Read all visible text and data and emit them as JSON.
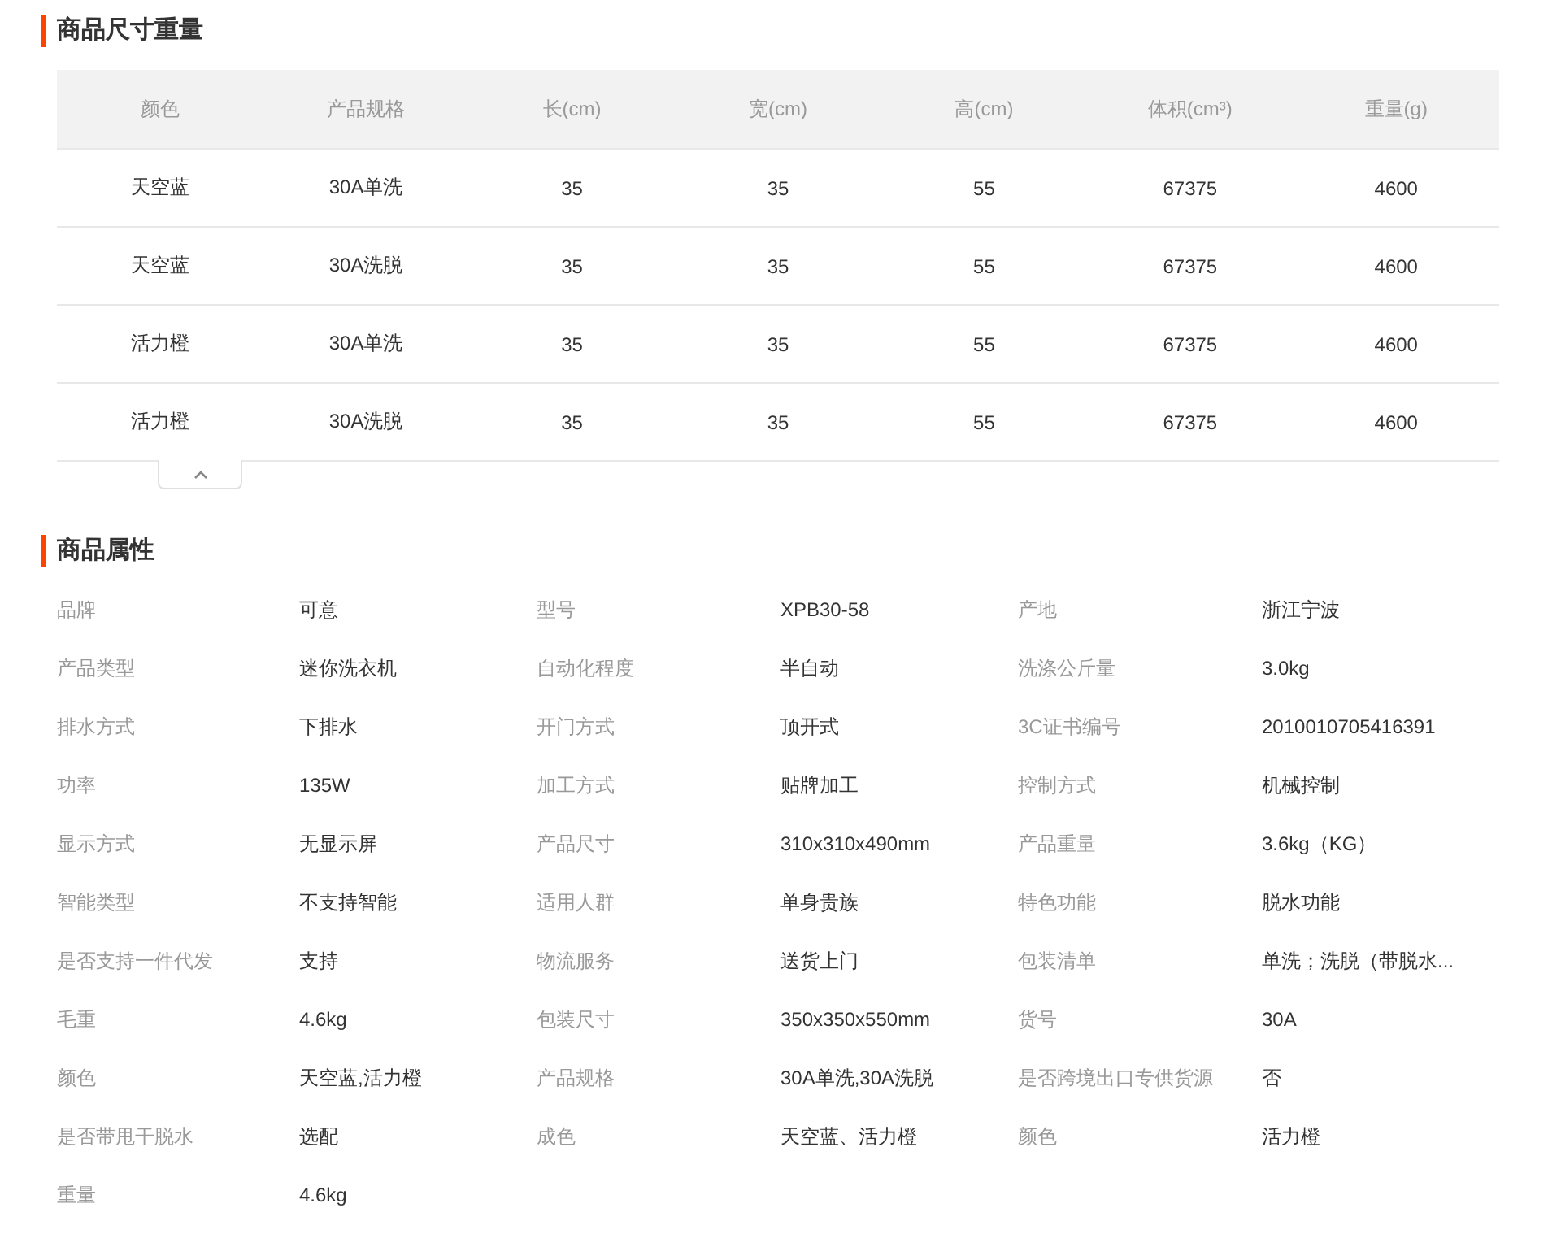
{
  "size_section": {
    "title": "商品尺寸重量",
    "columns": [
      "颜色",
      "产品规格",
      "长(cm)",
      "宽(cm)",
      "高(cm)",
      "体积(cm³)",
      "重量(g)"
    ],
    "rows": [
      [
        "天空蓝",
        "30A单洗",
        "35",
        "35",
        "55",
        "67375",
        "4600"
      ],
      [
        "天空蓝",
        "30A洗脱",
        "35",
        "35",
        "55",
        "67375",
        "4600"
      ],
      [
        "活力橙",
        "30A单洗",
        "35",
        "35",
        "55",
        "67375",
        "4600"
      ],
      [
        "活力橙",
        "30A洗脱",
        "35",
        "35",
        "55",
        "67375",
        "4600"
      ]
    ],
    "expanded": true
  },
  "attributes_section": {
    "title": "商品属性",
    "attributes": [
      {
        "label": "品牌",
        "value": "可意"
      },
      {
        "label": "型号",
        "value": "XPB30-58"
      },
      {
        "label": "产地",
        "value": "浙江宁波"
      },
      {
        "label": "产品类型",
        "value": "迷你洗衣机"
      },
      {
        "label": "自动化程度",
        "value": "半自动"
      },
      {
        "label": "洗涤公斤量",
        "value": "3.0kg"
      },
      {
        "label": "排水方式",
        "value": "下排水"
      },
      {
        "label": "开门方式",
        "value": "顶开式"
      },
      {
        "label": "3C证书编号",
        "value": "2010010705416391"
      },
      {
        "label": "功率",
        "value": "135W"
      },
      {
        "label": "加工方式",
        "value": "贴牌加工"
      },
      {
        "label": "控制方式",
        "value": "机械控制"
      },
      {
        "label": "显示方式",
        "value": "无显示屏"
      },
      {
        "label": "产品尺寸",
        "value": "310x310x490mm"
      },
      {
        "label": "产品重量",
        "value": "3.6kg（KG）"
      },
      {
        "label": "智能类型",
        "value": "不支持智能"
      },
      {
        "label": "适用人群",
        "value": "单身贵族"
      },
      {
        "label": "特色功能",
        "value": "脱水功能"
      },
      {
        "label": "是否支持一件代发",
        "value": "支持"
      },
      {
        "label": "物流服务",
        "value": "送货上门"
      },
      {
        "label": "包装清单",
        "value": "单洗；洗脱（带脱水..."
      },
      {
        "label": "毛重",
        "value": "4.6kg"
      },
      {
        "label": "包装尺寸",
        "value": "350x350x550mm"
      },
      {
        "label": "货号",
        "value": "30A"
      },
      {
        "label": "颜色",
        "value": "天空蓝,活力橙"
      },
      {
        "label": "产品规格",
        "value": "30A单洗,30A洗脱"
      },
      {
        "label": "是否跨境出口专供货源",
        "value": "否"
      },
      {
        "label": "是否带甩干脱水",
        "value": "选配"
      },
      {
        "label": "成色",
        "value": "天空蓝、活力橙"
      },
      {
        "label": "颜色",
        "value": "活力橙"
      },
      {
        "label": "重量",
        "value": "4.6kg"
      }
    ]
  }
}
